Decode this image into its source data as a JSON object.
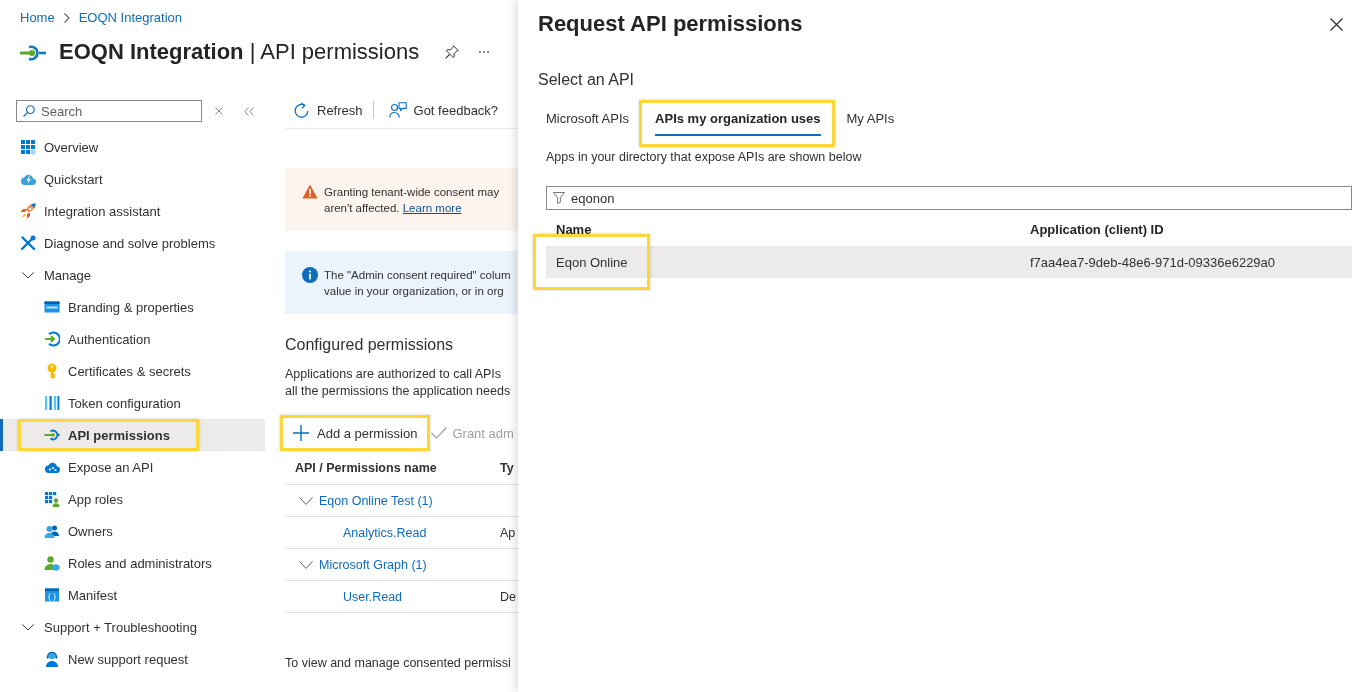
{
  "breadcrumb": [
    "Home",
    "EOQN Integration"
  ],
  "page_title": "**EOQN Integration** | API permissions",
  "sidebar": {
    "search": {
      "placeholder": "Search"
    },
    "items": [
      {
        "kind": "link",
        "label": "Overview",
        "selected": false,
        "highlighted": false
      },
      {
        "kind": "link",
        "label": "Quickstart",
        "selected": false,
        "highlighted": false
      },
      {
        "kind": "link",
        "label": "Integration assistant",
        "selected": false,
        "highlighted": false
      },
      {
        "kind": "link",
        "label": "Diagnose and solve problems",
        "selected": false,
        "highlighted": false
      },
      {
        "kind": "group",
        "label": "Manage",
        "expanded": true,
        "selected": false,
        "highlighted": false,
        "children": [
          {
            "label": "Branding & properties",
            "selected": false,
            "highlighted": false
          },
          {
            "label": "Authentication",
            "selected": false,
            "highlighted": false
          },
          {
            "label": "Certificates & secrets",
            "selected": false,
            "highlighted": false
          },
          {
            "label": "Token configuration",
            "selected": false,
            "highlighted": false
          },
          {
            "label": "API permissions",
            "selected": true,
            "highlighted": true
          },
          {
            "label": "Expose an API",
            "selected": false,
            "highlighted": false
          },
          {
            "label": "App roles",
            "selected": false,
            "highlighted": false
          },
          {
            "label": "Owners",
            "selected": false,
            "highlighted": false
          },
          {
            "label": "Roles and administrators",
            "selected": false,
            "highlighted": false
          },
          {
            "label": "Manifest",
            "selected": false,
            "highlighted": false
          }
        ]
      },
      {
        "kind": "group",
        "label": "Support + Troubleshooting",
        "expanded": true,
        "selected": false,
        "highlighted": false,
        "children": [
          {
            "label": "New support request",
            "selected": false,
            "highlighted": false
          }
        ]
      }
    ]
  },
  "toolbar": [
    {
      "kind": "refresh",
      "label": "Refresh"
    },
    {
      "kind": "feedback",
      "label": "Got feedback?"
    }
  ],
  "notices": [
    {
      "kind": "warning",
      "lines": [
        "Granting tenant-wide consent may",
        "aren't affected."
      ],
      "link": "Learn more"
    },
    {
      "kind": "info",
      "lines": [
        "The \"Admin consent required\" colum",
        "value in your organization, or in org"
      ]
    }
  ],
  "configured": {
    "heading": "Configured permissions",
    "description": [
      "Applications are authorized to call APIs",
      "all the permissions the application needs"
    ],
    "actions": [
      {
        "kind": "add",
        "label": "Add a permission",
        "disabled": false,
        "highlighted": true
      },
      {
        "kind": "grant",
        "label": "Grant adm",
        "disabled": true,
        "highlighted": false
      }
    ],
    "table": {
      "columns": [
        "API / Permissions name",
        "Ty"
      ],
      "groups": [
        {
          "name": "Eqon Online Test (1)",
          "expanded": true,
          "children": [
            {
              "name": "Analytics.Read",
              "column_2": "Ap"
            }
          ]
        },
        {
          "name": "Microsoft Graph (1)",
          "expanded": true,
          "children": [
            {
              "name": "User.Read",
              "column_2": "De"
            }
          ]
        }
      ]
    },
    "footer": "To view and manage consented permissi"
  },
  "panel": {
    "title": "Request API permissions",
    "subtitle": "Select an API",
    "tabs": [
      {
        "label": "Microsoft APIs",
        "selected": false,
        "highlighted": false
      },
      {
        "label": "APIs my organization uses",
        "selected": true,
        "highlighted": true
      },
      {
        "label": "My APIs",
        "selected": false,
        "highlighted": false
      }
    ],
    "hint": "Apps in your directory that expose APIs are shown below",
    "filter": {
      "value": "eqonon"
    },
    "columns": [
      "Name",
      "Application (client) ID"
    ],
    "rows": [
      {
        "name": "Eqon Online",
        "client_id": "f7aa4ea7-9deb-48e6-971d-09336e6229a0",
        "selected": true,
        "highlighted": true
      }
    ]
  }
}
